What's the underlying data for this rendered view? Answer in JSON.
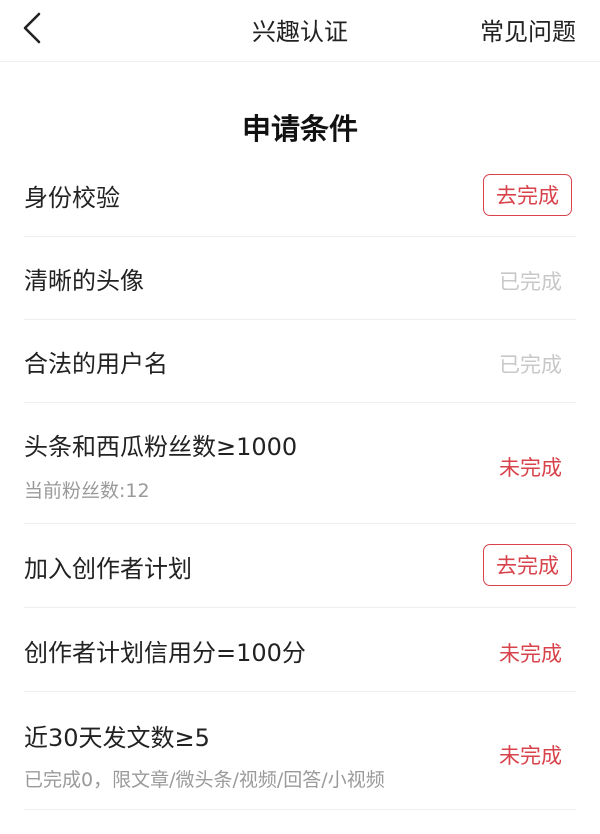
{
  "header": {
    "title": "兴趣认证",
    "help_label": "常见问题"
  },
  "section_title": "申请条件",
  "rows": [
    {
      "label": "身份校验",
      "status": "去完成"
    },
    {
      "label": "清晰的头像",
      "status": "已完成"
    },
    {
      "label": "合法的用户名",
      "status": "已完成"
    },
    {
      "label": "头条和西瓜粉丝数≥1000",
      "sub": "当前粉丝数:12",
      "status": "未完成"
    },
    {
      "label": "加入创作者计划",
      "status": "去完成"
    },
    {
      "label": "创作者计划信用分=100分",
      "status": "未完成"
    },
    {
      "label": "近30天发文数≥5",
      "sub": "已完成0，限文章/微头条/视频/回答/小视频",
      "status": "未完成"
    }
  ],
  "colors": {
    "accent_red": "#d8434b",
    "done_gray": "#c8c8c8",
    "sub_gray": "#9a9a9a",
    "divider": "#eeeeee"
  },
  "icons": {
    "back": "chevron-left-icon"
  }
}
